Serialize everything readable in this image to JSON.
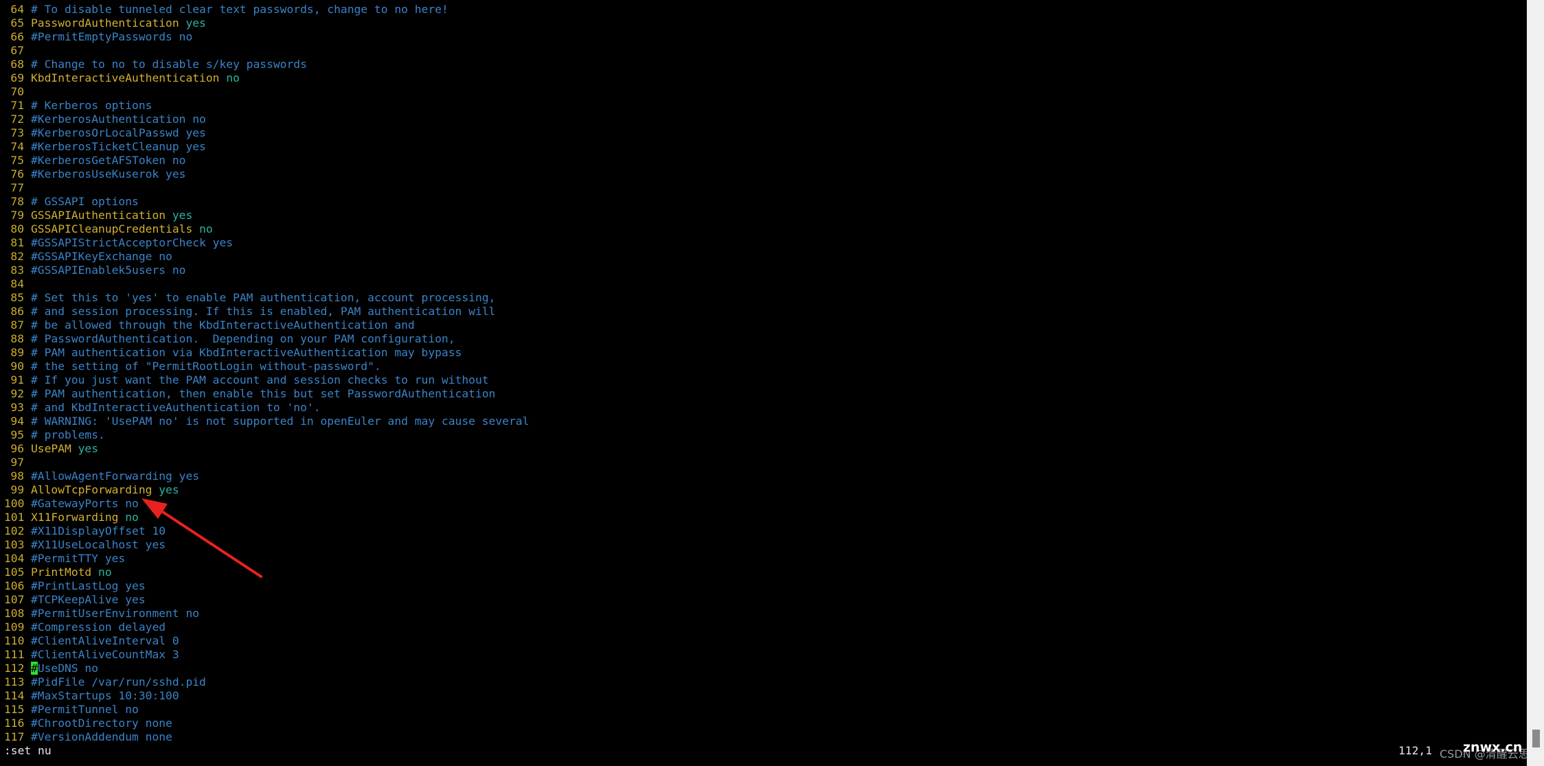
{
  "editor": {
    "colors": {
      "line_number": "#c9ad2e",
      "comment": "#3b83c8",
      "keyword": "#d2b030",
      "value": "#2bb3a3",
      "cursor": "#2fe02f",
      "annotation_arrow": "#e8221f"
    },
    "lines": [
      {
        "n": "64",
        "s": [
          [
            "c",
            "# To disable tunneled clear text passwords, change to no here!"
          ]
        ]
      },
      {
        "n": "65",
        "s": [
          [
            "k",
            "PasswordAuthentication "
          ],
          [
            "v",
            "yes"
          ]
        ]
      },
      {
        "n": "66",
        "s": [
          [
            "c",
            "#PermitEmptyPasswords no"
          ]
        ]
      },
      {
        "n": "67",
        "s": []
      },
      {
        "n": "68",
        "s": [
          [
            "c",
            "# Change to no to disable s/key passwords"
          ]
        ]
      },
      {
        "n": "69",
        "s": [
          [
            "k",
            "KbdInteractiveAuthentication "
          ],
          [
            "v",
            "no"
          ]
        ]
      },
      {
        "n": "70",
        "s": []
      },
      {
        "n": "71",
        "s": [
          [
            "c",
            "# Kerberos options"
          ]
        ]
      },
      {
        "n": "72",
        "s": [
          [
            "c",
            "#KerberosAuthentication no"
          ]
        ]
      },
      {
        "n": "73",
        "s": [
          [
            "c",
            "#KerberosOrLocalPasswd yes"
          ]
        ]
      },
      {
        "n": "74",
        "s": [
          [
            "c",
            "#KerberosTicketCleanup yes"
          ]
        ]
      },
      {
        "n": "75",
        "s": [
          [
            "c",
            "#KerberosGetAFSToken no"
          ]
        ]
      },
      {
        "n": "76",
        "s": [
          [
            "c",
            "#KerberosUseKuserok yes"
          ]
        ]
      },
      {
        "n": "77",
        "s": []
      },
      {
        "n": "78",
        "s": [
          [
            "c",
            "# GSSAPI options"
          ]
        ]
      },
      {
        "n": "79",
        "s": [
          [
            "k",
            "GSSAPIAuthentication "
          ],
          [
            "v",
            "yes"
          ]
        ]
      },
      {
        "n": "80",
        "s": [
          [
            "k",
            "GSSAPICleanupCredentials "
          ],
          [
            "v",
            "no"
          ]
        ]
      },
      {
        "n": "81",
        "s": [
          [
            "c",
            "#GSSAPIStrictAcceptorCheck yes"
          ]
        ]
      },
      {
        "n": "82",
        "s": [
          [
            "c",
            "#GSSAPIKeyExchange no"
          ]
        ]
      },
      {
        "n": "83",
        "s": [
          [
            "c",
            "#GSSAPIEnablek5users no"
          ]
        ]
      },
      {
        "n": "84",
        "s": []
      },
      {
        "n": "85",
        "s": [
          [
            "c",
            "# Set this to 'yes' to enable PAM authentication, account processing,"
          ]
        ]
      },
      {
        "n": "86",
        "s": [
          [
            "c",
            "# and session processing. If this is enabled, PAM authentication will"
          ]
        ]
      },
      {
        "n": "87",
        "s": [
          [
            "c",
            "# be allowed through the KbdInteractiveAuthentication and"
          ]
        ]
      },
      {
        "n": "88",
        "s": [
          [
            "c",
            "# PasswordAuthentication.  Depending on your PAM configuration,"
          ]
        ]
      },
      {
        "n": "89",
        "s": [
          [
            "c",
            "# PAM authentication via KbdInteractiveAuthentication may bypass"
          ]
        ]
      },
      {
        "n": "90",
        "s": [
          [
            "c",
            "# the setting of \"PermitRootLogin without-password\"."
          ]
        ]
      },
      {
        "n": "91",
        "s": [
          [
            "c",
            "# If you just want the PAM account and session checks to run without"
          ]
        ]
      },
      {
        "n": "92",
        "s": [
          [
            "c",
            "# PAM authentication, then enable this but set PasswordAuthentication"
          ]
        ]
      },
      {
        "n": "93",
        "s": [
          [
            "c",
            "# and KbdInteractiveAuthentication to 'no'."
          ]
        ]
      },
      {
        "n": "94",
        "s": [
          [
            "c",
            "# WARNING: 'UsePAM no' is not supported in openEuler and may cause several"
          ]
        ]
      },
      {
        "n": "95",
        "s": [
          [
            "c",
            "# problems."
          ]
        ]
      },
      {
        "n": "96",
        "s": [
          [
            "k",
            "UsePAM "
          ],
          [
            "v",
            "yes"
          ]
        ]
      },
      {
        "n": "97",
        "s": []
      },
      {
        "n": "98",
        "s": [
          [
            "c",
            "#AllowAgentForwarding yes"
          ]
        ]
      },
      {
        "n": "99",
        "s": [
          [
            "k",
            "AllowTcpForwarding "
          ],
          [
            "v",
            "yes"
          ]
        ]
      },
      {
        "n": "100",
        "s": [
          [
            "c",
            "#GatewayPorts no"
          ]
        ]
      },
      {
        "n": "101",
        "s": [
          [
            "k",
            "X11Forwarding "
          ],
          [
            "v",
            "no"
          ]
        ]
      },
      {
        "n": "102",
        "s": [
          [
            "c",
            "#X11DisplayOffset 10"
          ]
        ]
      },
      {
        "n": "103",
        "s": [
          [
            "c",
            "#X11UseLocalhost yes"
          ]
        ]
      },
      {
        "n": "104",
        "s": [
          [
            "c",
            "#PermitTTY yes"
          ]
        ]
      },
      {
        "n": "105",
        "s": [
          [
            "k",
            "PrintMotd "
          ],
          [
            "v",
            "no"
          ]
        ]
      },
      {
        "n": "106",
        "s": [
          [
            "c",
            "#PrintLastLog yes"
          ]
        ]
      },
      {
        "n": "107",
        "s": [
          [
            "c",
            "#TCPKeepAlive yes"
          ]
        ]
      },
      {
        "n": "108",
        "s": [
          [
            "c",
            "#PermitUserEnvironment no"
          ]
        ]
      },
      {
        "n": "109",
        "s": [
          [
            "c",
            "#Compression delayed"
          ]
        ]
      },
      {
        "n": "110",
        "s": [
          [
            "c",
            "#ClientAliveInterval 0"
          ]
        ]
      },
      {
        "n": "111",
        "s": [
          [
            "c",
            "#ClientAliveCountMax 3"
          ]
        ]
      },
      {
        "n": "112",
        "s": [
          [
            "cur",
            "#"
          ],
          [
            "c",
            "UseDNS no"
          ]
        ]
      },
      {
        "n": "113",
        "s": [
          [
            "c",
            "#PidFile /var/run/sshd.pid"
          ]
        ]
      },
      {
        "n": "114",
        "s": [
          [
            "c",
            "#MaxStartups 10:30:100"
          ]
        ]
      },
      {
        "n": "115",
        "s": [
          [
            "c",
            "#PermitTunnel no"
          ]
        ]
      },
      {
        "n": "116",
        "s": [
          [
            "c",
            "#ChrootDirectory none"
          ]
        ]
      },
      {
        "n": "117",
        "s": [
          [
            "c",
            "#VersionAddendum none"
          ]
        ]
      }
    ],
    "command_line": ":set nu",
    "cursor_position": "112,1",
    "watermark": "CSDN @清醒云思",
    "watermark_overlay": "znwx.cn"
  }
}
